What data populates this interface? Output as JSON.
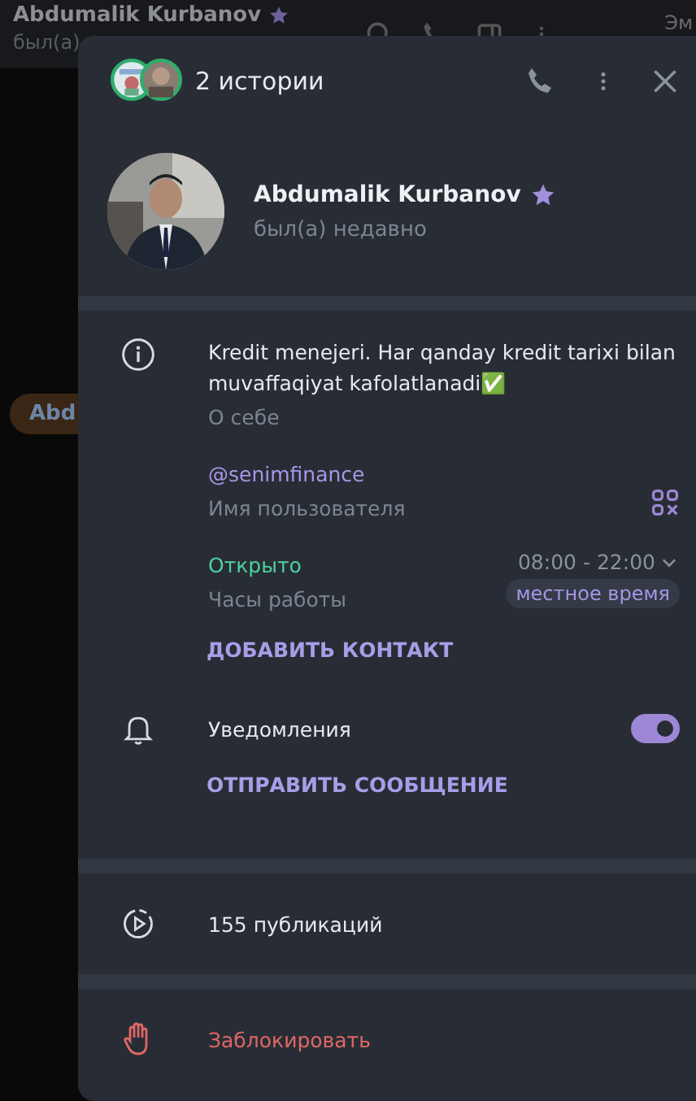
{
  "background_chat": {
    "title": "Abdumalik Kurbanov",
    "starred": true,
    "status": "был(а)",
    "right_text": "Эм",
    "chip": "Abd"
  },
  "dialog": {
    "title": "2 истории"
  },
  "profile": {
    "name": "Abdumalik Kurbanov",
    "starred": true,
    "status": "был(а) недавно"
  },
  "info": {
    "bio": "Kredit menejeri. Har qanday kredit tarixi bilan muvaffaqiyat kafolatlanadi✅",
    "bio_label": "О себе",
    "username": "@senimfinance",
    "username_label": "Имя пользователя",
    "hours_status": "Открыто",
    "hours": "08:00 - 22:00",
    "hours_label": "Часы работы",
    "hours_badge": "местное время",
    "add_contact": "ДОБАВИТЬ КОНТАКТ"
  },
  "notifications": {
    "label": "Уведомления",
    "on": true,
    "send_message": "ОТПРАВИТЬ СООБЩЕНИЕ"
  },
  "publications": "155 публикаций",
  "block": "Заблокировать"
}
